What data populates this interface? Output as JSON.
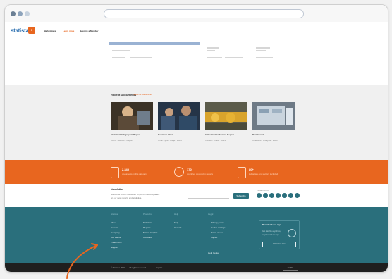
{
  "colors": {
    "orange": "#e8661f",
    "teal": "#2a6f7c",
    "dark": "#1f1f1f",
    "window_dots": [
      "#6b7f94",
      "#8ea4bc",
      "#c7d2de"
    ]
  },
  "icons": {
    "window_controls": [
      "window-dot-icon",
      "window-dot-icon",
      "window-dot-icon"
    ],
    "stats": [
      "document-icon",
      "globe-icon",
      "building-icon"
    ],
    "social": [
      "facebook-icon",
      "twitter-icon",
      "linkedin-icon",
      "youtube-icon",
      "instagram-icon",
      "rss-icon",
      "mail-icon"
    ],
    "annotation": "orange-arrow-icon"
  },
  "site": {
    "logo_text": "statista",
    "logo_badge": "●"
  },
  "nav": {
    "items": [
      {
        "label": "Marketplace"
      },
      {
        "label": "Learn more"
      },
      {
        "label": "Become a Member"
      }
    ]
  },
  "section": {
    "title": "Recent Documents",
    "title_link": "Show all documents"
  },
  "docs": [
    {
      "title": "Statistical Infographic Report",
      "meta": "2024 · Statistic · Report"
    },
    {
      "title": "Business Chart",
      "meta": "Chart Type · Page · 2024"
    },
    {
      "title": "Industrial Production Report",
      "meta": "Industry · Data · 2024"
    },
    {
      "title": "Dashboard",
      "meta": "Overview · Analysis · 2024"
    }
  ],
  "stats": [
    {
      "num": "2,340",
      "sub": "documents in this category"
    },
    {
      "num": "170",
      "sub": "countries covered in reports"
    },
    {
      "num": "80+",
      "sub": "industries and sectors included"
    }
  ],
  "newsletter": {
    "title": "Newsletter",
    "text_line1": "Subscribe to our newsletter to get the latest updates",
    "text_line2": "on our new reports and statistics.",
    "button": "Subscribe",
    "social_label": "Follow us on"
  },
  "footer": {
    "col1_head": "Statista",
    "col1": [
      "About",
      "Careers",
      "Company",
      "Our clients",
      "Press room",
      "Support"
    ],
    "col2_head": "Products",
    "col2": [
      "Statistics",
      "Reports",
      "Market Insights",
      "Outlooks"
    ],
    "col3_head": "Help",
    "col3": [
      "FAQ",
      "Contact"
    ],
    "col4_head": "Legal",
    "col4": [
      "Privacy policy",
      "Cookie settings",
      "Terms of use",
      "Imprint"
    ],
    "col4_bottom": "Help Center",
    "app": {
      "title": "Download our app",
      "text1": "Get insights anywhere,",
      "text2": "anytime with the app",
      "button": "Download now"
    }
  },
  "bottom": {
    "links": [
      "© Statista 2024",
      "All rights reserved",
      "Imprint"
    ],
    "language": "English"
  }
}
